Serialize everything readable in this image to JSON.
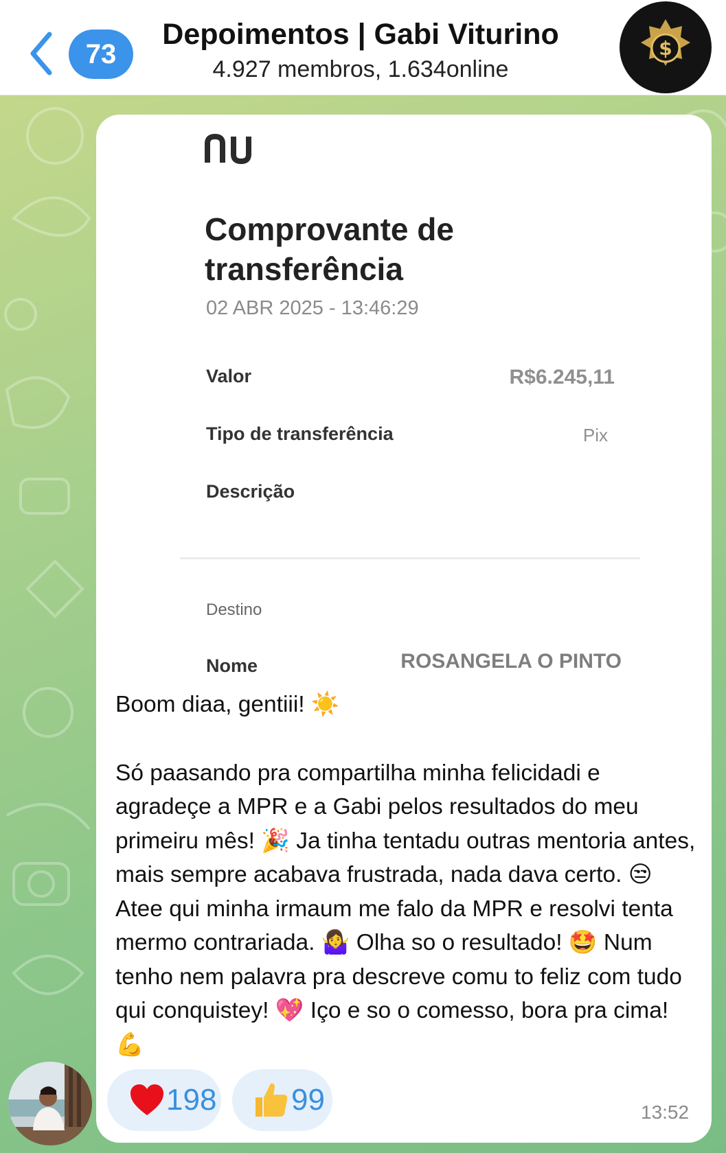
{
  "header": {
    "back_badge": "73",
    "title": "Depoimentos | Gabi Viturino",
    "subtitle": "4.927 membros, 1.634online",
    "avatar_icon": "gold-dollar-emblem-icon",
    "back_icon": "chevron-left-icon"
  },
  "receipt": {
    "logo": "nu",
    "title": "Comprovante de transferência",
    "datetime": "02 ABR 2025 - 13:46:29",
    "rows": [
      {
        "label": "Valor",
        "value": "R$6.245,11"
      },
      {
        "label": "Tipo de transferência",
        "value": "Pix"
      },
      {
        "label": "Descrição",
        "value": ""
      }
    ],
    "section": "Destino",
    "name_label": "Nome",
    "name_value": "ROSANGELA O PINTO"
  },
  "message": {
    "greeting": "Boom diaa, gentiii! ☀️",
    "body": "Só paasando pra compartilha minha felicidadi e agradeçe a MPR e a Gabi pelos resultados do meu primeiru mês! 🎉 Ja tinha tentadu outras mentoria antes, mais sempre acabava frustrada, nada dava certo. 😒 Atee qui minha irmaum me falo da MPR e resolvi tenta mermo contrariada. 🤷‍♀️ Olha so o resultado! 🤩 Num tenho nem palavra pra descreve comu to feliz com tudo qui conquistey! 💖 Iço e so o comesso, bora pra cima! 💪",
    "time": "13:52"
  },
  "reactions": [
    {
      "emoji": "heart-icon",
      "count": "198"
    },
    {
      "emoji": "thumbs-up-icon",
      "count": "99"
    }
  ],
  "colors": {
    "accent": "#3b93ea",
    "reaction_bg": "#e5f0fb",
    "reaction_text": "#3a8fdc",
    "wallpaper_start": "#c9d98a",
    "wallpaper_end": "#79bd85"
  }
}
